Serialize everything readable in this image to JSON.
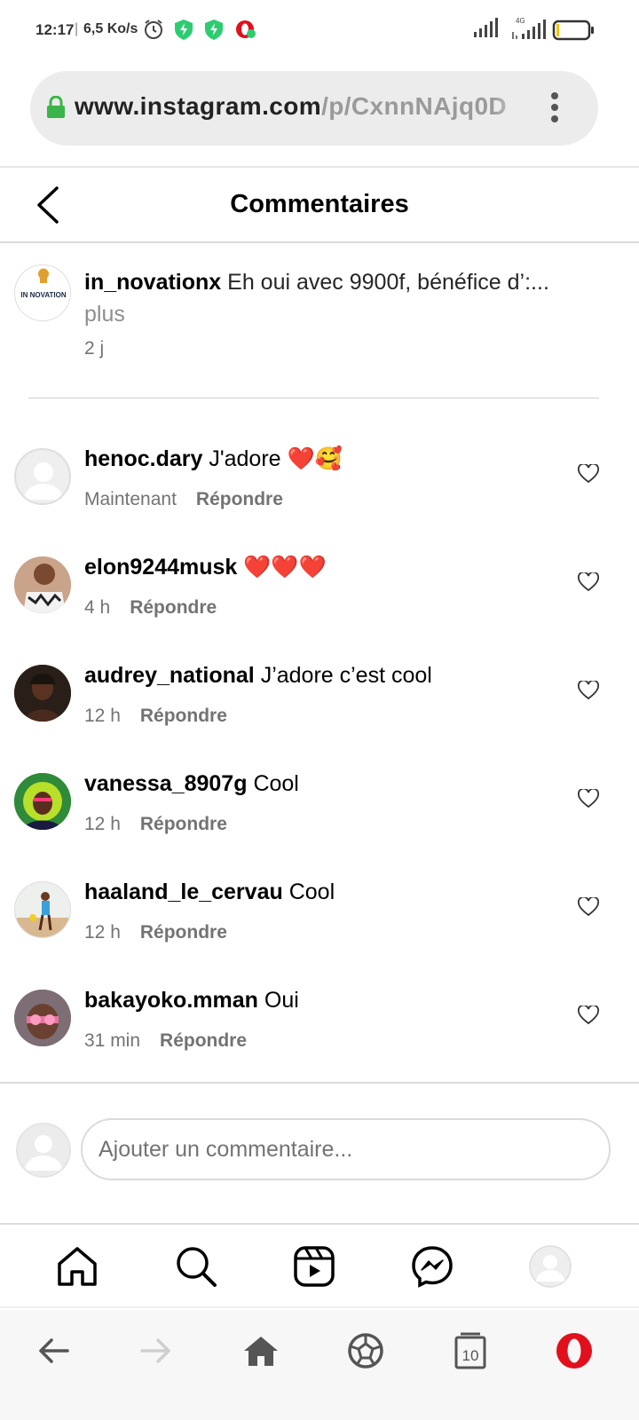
{
  "status_bar": {
    "time": "12:17",
    "speed": "6,5 Ko/s",
    "network": "4G",
    "icons": [
      "alarm-icon",
      "vpn-shield-icon",
      "vpn-shield-icon",
      "opera-update-icon",
      "signal-icon",
      "signal-4g-icon",
      "battery-icon"
    ]
  },
  "browser": {
    "url_host": "www.instagram.com",
    "url_path": "/p/CxnnNAjq0D",
    "tab_count": "10"
  },
  "header": {
    "title": "Commentaires"
  },
  "caption": {
    "username": "in_novationx",
    "text": "Eh oui avec 9900f, bénéfice d’:...",
    "more": "plus",
    "time": "2 j",
    "avatar_label": "IN NOVATION"
  },
  "comments": [
    {
      "username": "henoc.dary",
      "text": "J'adore ❤️🥰",
      "time": "Maintenant",
      "reply": "Répondre",
      "avatar": "default"
    },
    {
      "username": "elon9244musk",
      "text": "❤️❤️❤️",
      "time": "4 h",
      "reply": "Répondre",
      "avatar": "photo"
    },
    {
      "username": "audrey_national",
      "text": "J’adore c’est cool",
      "time": "12 h",
      "reply": "Répondre",
      "avatar": "photo"
    },
    {
      "username": "vanessa_8907g",
      "text": "Cool",
      "time": "12 h",
      "reply": "Répondre",
      "avatar": "photo"
    },
    {
      "username": "haaland_le_cervau",
      "text": "Cool",
      "time": "12 h",
      "reply": "Répondre",
      "avatar": "photo"
    },
    {
      "username": "bakayoko.mman",
      "text": "Oui",
      "time": "31 min",
      "reply": "Répondre",
      "avatar": "photo"
    }
  ],
  "composer": {
    "placeholder": "Ajouter un commentaire..."
  },
  "colors": {
    "accent_green": "#2ecc71",
    "opera_red": "#e0101d",
    "secondary_text": "#737373"
  }
}
